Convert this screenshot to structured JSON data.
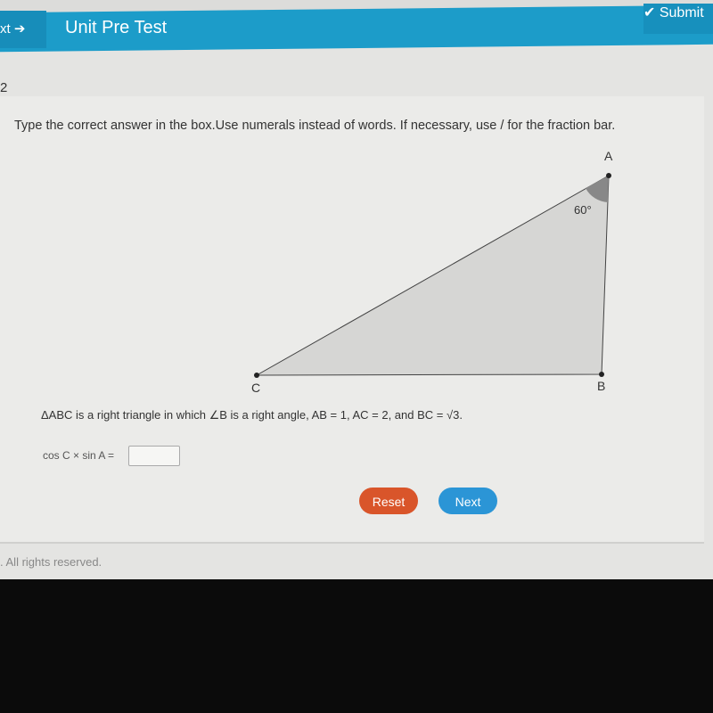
{
  "header": {
    "prev_label": "xt",
    "title": "Unit Pre Test",
    "submit_label": "Submit"
  },
  "question": {
    "number": "2",
    "instructions": "Type the correct answer in the box.Use numerals instead of words. If necessary, use / for the fraction bar.",
    "statement": "ΔABC is a right triangle in which ∠B is a right angle, AB = 1, AC = 2, and BC = √3.",
    "equation_label": "cos C × sin A =",
    "answer_value": ""
  },
  "diagram": {
    "vertices": [
      "A",
      "B",
      "C"
    ],
    "angle_label": "60°",
    "fill": "#d6d6d4"
  },
  "buttons": {
    "reset": "Reset",
    "next": "Next",
    "reset_color": "#d9552a",
    "next_color": "#2b95d6"
  },
  "footer": {
    "text": ". All rights reserved."
  }
}
